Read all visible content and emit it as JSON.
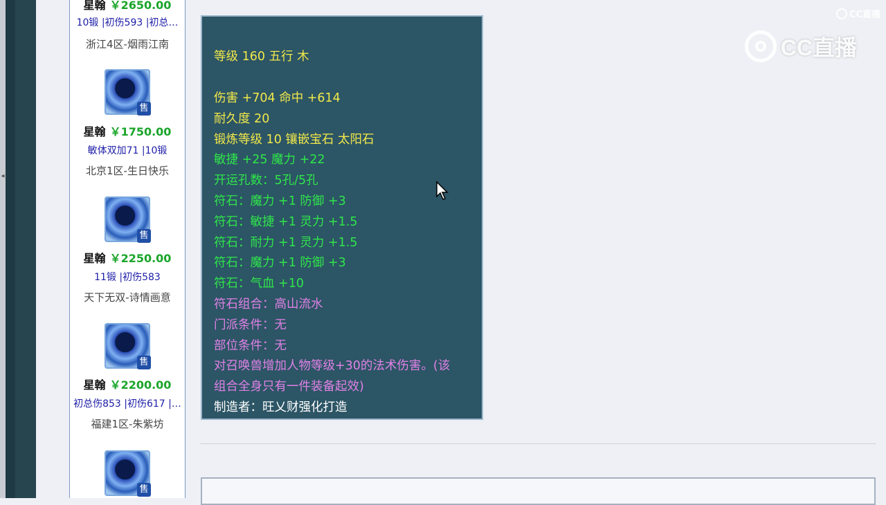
{
  "sidebar": {
    "items": [
      {
        "name": "星翰",
        "price": "￥2650.00",
        "tags": "10锻 |初伤593 |初总…",
        "server": "浙江4区-烟雨江南",
        "sell": "售"
      },
      {
        "name": "星翰",
        "price": "￥1750.00",
        "tags": "敏体双加71 |10锻",
        "server": "北京1区-生日快乐",
        "sell": "售"
      },
      {
        "name": "星翰",
        "price": "￥2250.00",
        "tags": "11锻 |初伤583",
        "server": "天下无双-诗情画意",
        "sell": "售"
      },
      {
        "name": "星翰",
        "price": "￥2200.00",
        "tags": "初总伤853 |初伤617 |…",
        "server": "福建1区-朱紫坊",
        "sell": "售"
      },
      {
        "name": "",
        "price": "",
        "tags": "",
        "server": "",
        "sell": "售"
      }
    ]
  },
  "tooltip": {
    "lines": [
      {
        "text": "等级 160 五行 木",
        "color": "#f2e94a"
      },
      {
        "text": "伤害 +704 命中 +614",
        "color": "#f2e94a"
      },
      {
        "text": "耐久度 20",
        "color": "#f2e94a"
      },
      {
        "text": "锻炼等级 10 镶嵌宝石 太阳石",
        "color": "#f2e94a"
      },
      {
        "text": "敏捷 +25 魔力 +22",
        "color": "#2fe64a"
      },
      {
        "text": "开运孔数：5孔/5孔",
        "color": "#2fe64a"
      },
      {
        "text": "符石：魔力 +1 防御 +3",
        "color": "#2fe64a"
      },
      {
        "text": "符石：敏捷 +1 灵力 +1.5",
        "color": "#2fe64a"
      },
      {
        "text": "符石：耐力 +1 灵力 +1.5",
        "color": "#2fe64a"
      },
      {
        "text": "符石：魔力 +1 防御 +3",
        "color": "#2fe64a"
      },
      {
        "text": "符石：气血 +10",
        "color": "#2fe64a"
      },
      {
        "text": "符石组合：高山流水",
        "color": "#e081e6"
      },
      {
        "text": "门派条件：无",
        "color": "#e081e6"
      },
      {
        "text": "部位条件：无",
        "color": "#e081e6"
      },
      {
        "text": "对召唤兽增加人物等级+30的法术伤害。(该",
        "color": "#e081e6"
      },
      {
        "text": "组合全身只有一件装备起效)",
        "color": "#e081e6"
      },
      {
        "text": "制造者：旺乂财强化打造",
        "color": "#ffffff"
      }
    ]
  },
  "watermark": {
    "brand": "CC直播",
    "small": "CC直播"
  }
}
